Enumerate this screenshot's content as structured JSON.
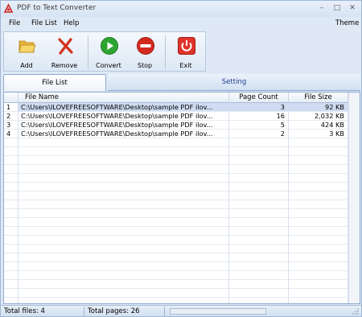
{
  "window": {
    "title": "PDF to Text Converter",
    "minimize": "–",
    "maximize": "□",
    "close": "✕"
  },
  "menu": {
    "file": "File",
    "file_list": "File List",
    "help": "Help",
    "theme": "Theme"
  },
  "toolbar": {
    "add": "Add",
    "remove": "Remove",
    "convert": "Convert",
    "stop": "Stop",
    "exit": "Exit"
  },
  "tabs": {
    "file_list": "File List",
    "setting": "Setting"
  },
  "table": {
    "headers": {
      "name": "File Name",
      "pages": "Page Count",
      "size": "File Size"
    },
    "rows": [
      {
        "idx": "1",
        "name": "C:\\Users\\ILOVEFREESOFTWARE\\Desktop\\sample PDF ilov...",
        "pages": "3",
        "size": "92 KB"
      },
      {
        "idx": "2",
        "name": "C:\\Users\\ILOVEFREESOFTWARE\\Desktop\\sample PDF ilov...",
        "pages": "16",
        "size": "2,032 KB"
      },
      {
        "idx": "3",
        "name": "C:\\Users\\ILOVEFREESOFTWARE\\Desktop\\sample PDF ilov...",
        "pages": "5",
        "size": "424 KB"
      },
      {
        "idx": "4",
        "name": "C:\\Users\\ILOVEFREESOFTWARE\\Desktop\\sample PDF ilov...",
        "pages": "2",
        "size": "3 KB"
      }
    ]
  },
  "status": {
    "total_files": "Total files: 4",
    "total_pages": "Total pages: 26",
    "progress_fraction": 0
  },
  "colors": {
    "accent": "#1c3f8c",
    "convert_green": "#2fa531",
    "stop_red": "#d32a1f",
    "exit_red": "#e0332a"
  }
}
